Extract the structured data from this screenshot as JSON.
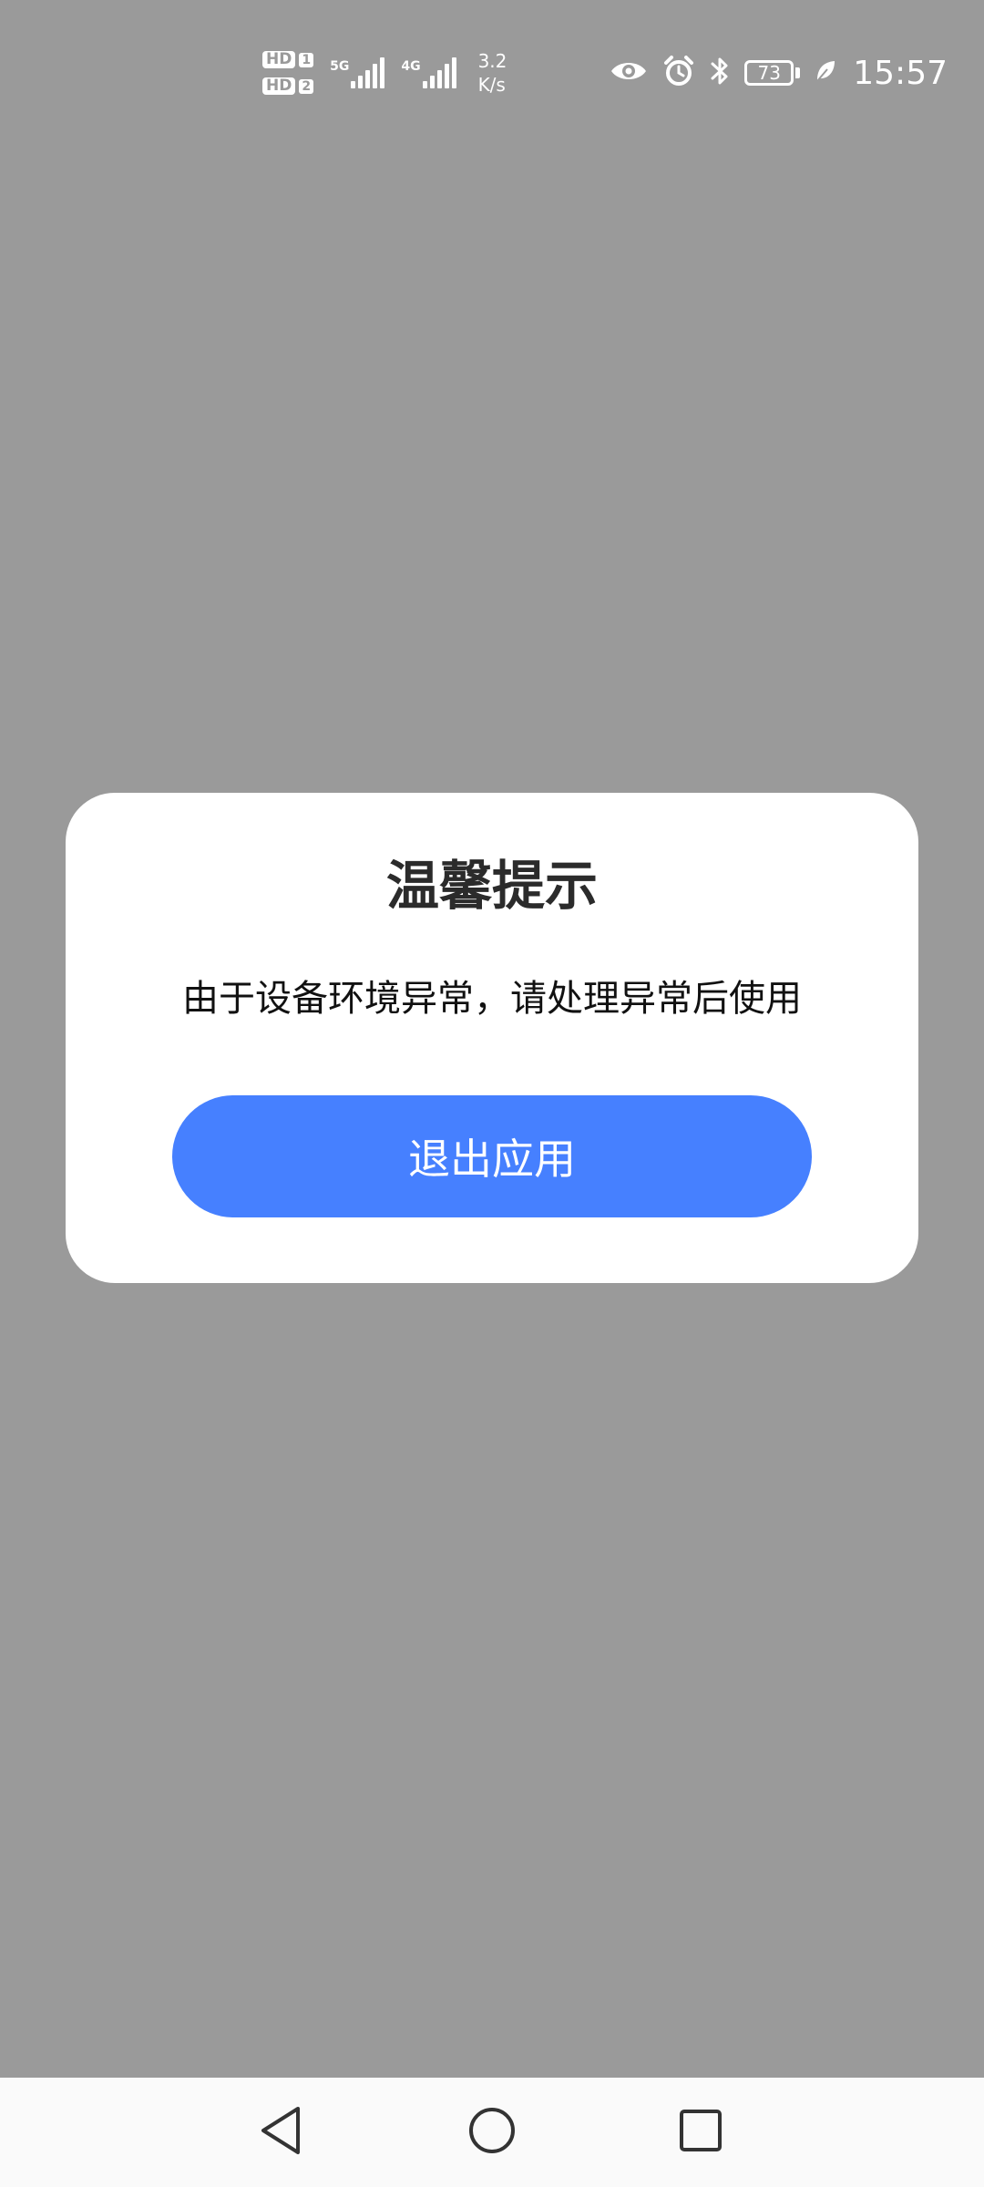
{
  "status_bar": {
    "sim1_label": "HD",
    "sim1_number": "1",
    "sim2_label": "HD",
    "sim2_number": "2",
    "net1_type": "5G",
    "net2_type": "4G",
    "speed_value": "3.2",
    "speed_unit": "K/s",
    "battery_level": "73",
    "time": "15:57",
    "icons": [
      "eye-comfort-icon",
      "alarm-icon",
      "bluetooth-icon",
      "battery-icon",
      "power-saving-leaf-icon"
    ]
  },
  "dialog": {
    "title": "温馨提示",
    "message": "由于设备环境异常，请处理异常后使用",
    "button_label": "退出应用"
  },
  "nav_bar": {
    "icons": [
      "back-icon",
      "home-icon",
      "recents-icon"
    ]
  },
  "colors": {
    "overlay": "#9a9a9a",
    "dialog_bg": "#ffffff",
    "accent": "#4680ff",
    "nav_bg": "#fafafa"
  }
}
